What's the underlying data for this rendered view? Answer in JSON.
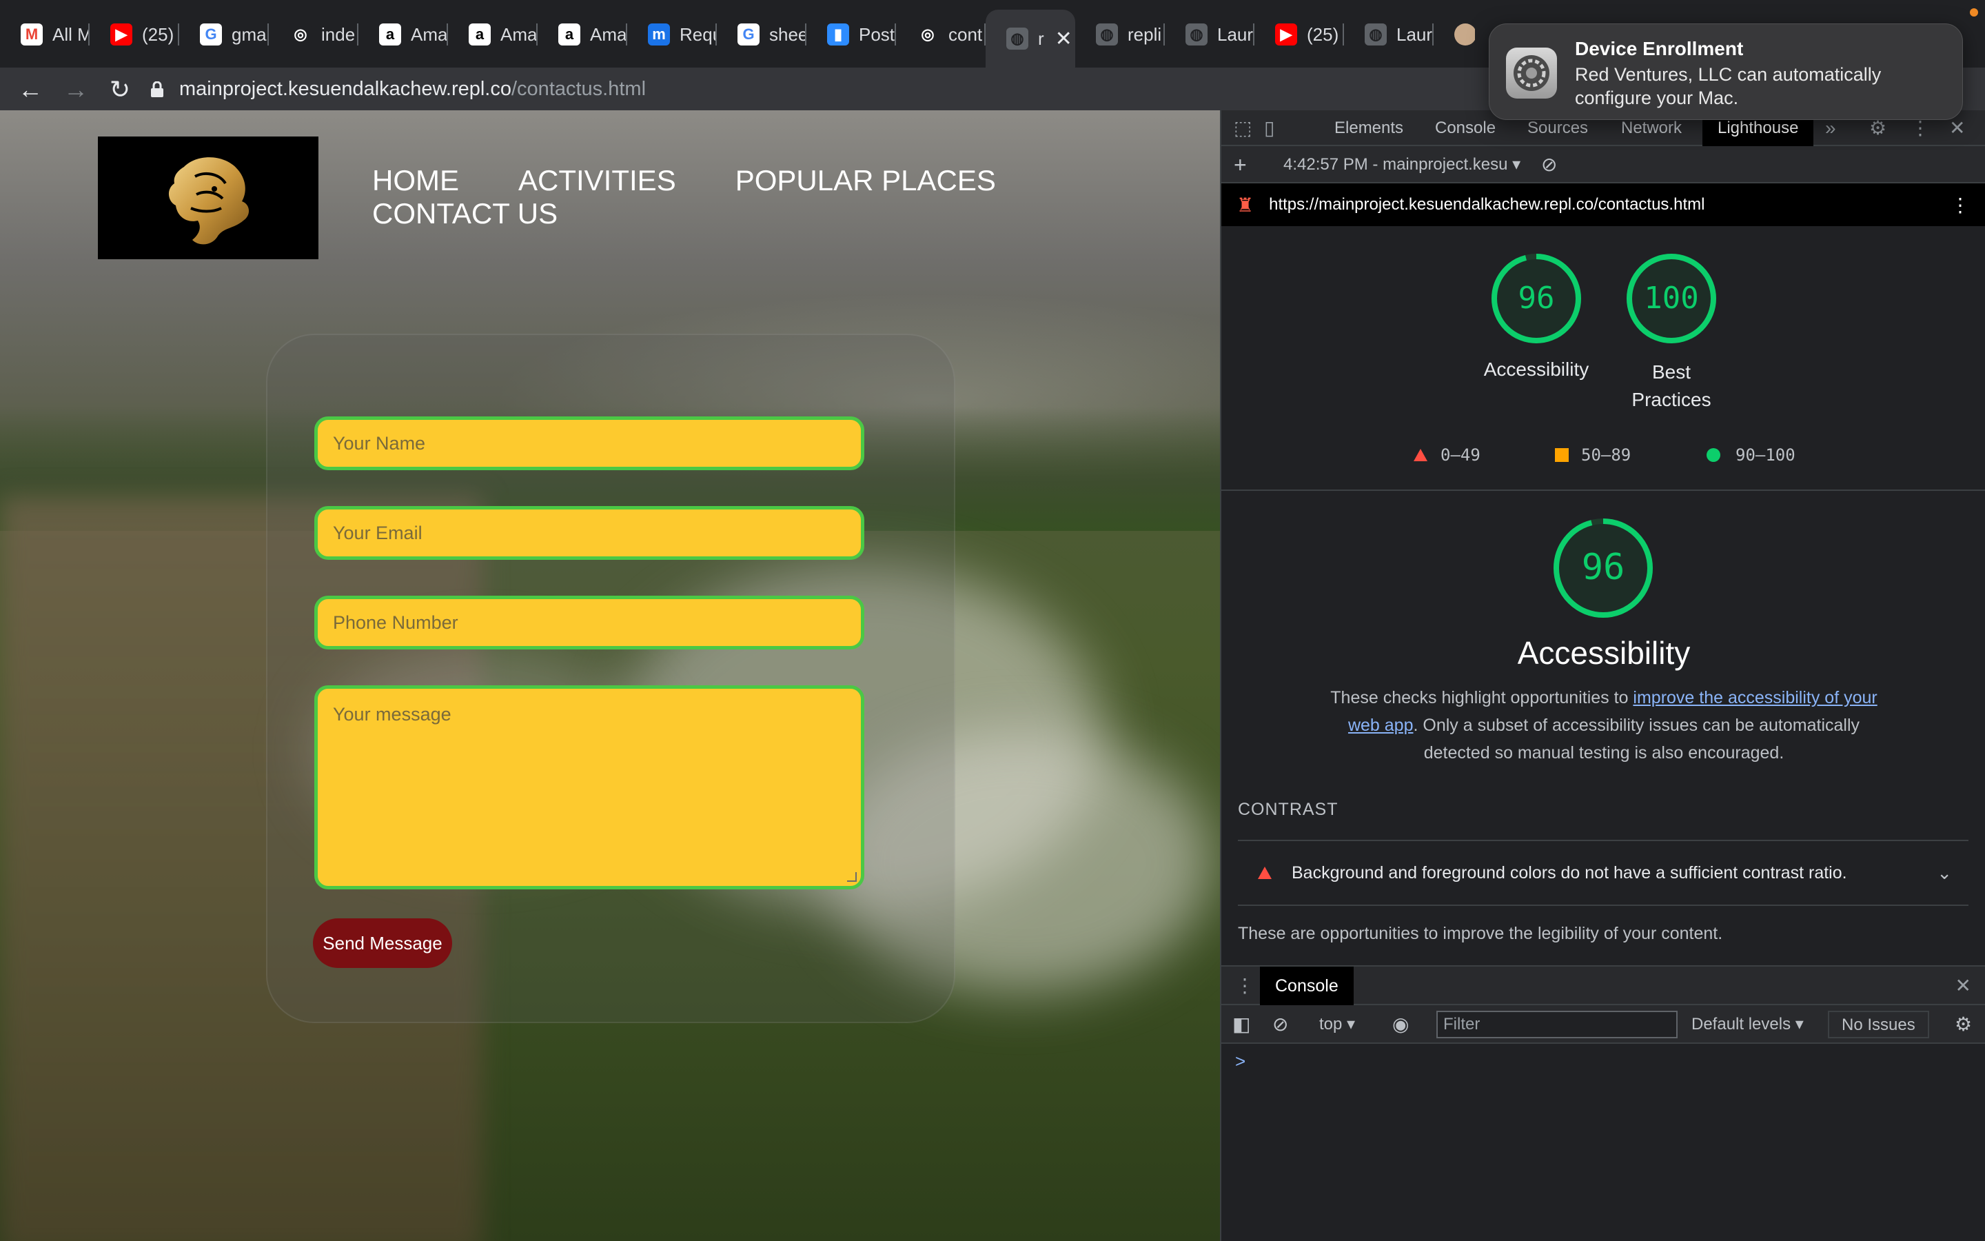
{
  "browser": {
    "tabs": [
      {
        "icon": "gmail-icon",
        "label": "All M",
        "fav_bg": "#ffffff",
        "fav_fg": "#ea4335",
        "glyph": "M"
      },
      {
        "icon": "youtube-icon",
        "label": "(25)",
        "fav_bg": "#ff0000",
        "fav_fg": "#ffffff",
        "glyph": "▶"
      },
      {
        "icon": "google-icon",
        "label": "gmai",
        "fav_bg": "#ffffff",
        "fav_fg": "#4285f4",
        "glyph": "G"
      },
      {
        "icon": "replit-icon",
        "label": "inde",
        "fav_bg": "#202124",
        "fav_fg": "#ffffff",
        "glyph": "◎"
      },
      {
        "icon": "amazon-icon",
        "label": "Ama",
        "fav_bg": "#ffffff",
        "fav_fg": "#000000",
        "glyph": "a"
      },
      {
        "icon": "amazon-icon",
        "label": "Ama",
        "fav_bg": "#ffffff",
        "fav_fg": "#000000",
        "glyph": "a"
      },
      {
        "icon": "amazon-icon",
        "label": "Ama",
        "fav_bg": "#ffffff",
        "fav_fg": "#000000",
        "glyph": "a"
      },
      {
        "icon": "m-icon",
        "label": "Requ",
        "fav_bg": "#1a73e8",
        "fav_fg": "#ffffff",
        "glyph": "m"
      },
      {
        "icon": "google-icon",
        "label": "shee",
        "fav_bg": "#ffffff",
        "fav_fg": "#4285f4",
        "glyph": "G"
      },
      {
        "icon": "zoom-icon",
        "label": "Post",
        "fav_bg": "#2d8cff",
        "fav_fg": "#ffffff",
        "glyph": "▮"
      },
      {
        "icon": "replit-icon",
        "label": "cont",
        "fav_bg": "#202124",
        "fav_fg": "#ffffff",
        "glyph": "◎"
      },
      {
        "icon": "globe-icon",
        "label": "r",
        "fav_bg": "#5f6368",
        "fav_fg": "#202124",
        "glyph": "◍",
        "active": true
      },
      {
        "icon": "globe-icon",
        "label": "repli",
        "fav_bg": "#5f6368",
        "fav_fg": "#202124",
        "glyph": "◍"
      },
      {
        "icon": "globe-icon",
        "label": "Laur",
        "fav_bg": "#5f6368",
        "fav_fg": "#202124",
        "glyph": "◍"
      },
      {
        "icon": "youtube-icon",
        "label": "(25)",
        "fav_bg": "#ff0000",
        "fav_fg": "#ffffff",
        "glyph": "▶"
      },
      {
        "icon": "globe-icon",
        "label": "Laur",
        "fav_bg": "#5f6368",
        "fav_fg": "#202124",
        "glyph": "◍"
      }
    ],
    "url_host": "mainproject.kesuendalkachew.repl.co",
    "url_path": "/contactus.html"
  },
  "site": {
    "nav": [
      "HOME",
      "ACTIVITIES",
      "POPULAR PLACES",
      "CONTACT US"
    ],
    "form": {
      "name_placeholder": "Your Name",
      "email_placeholder": "Your Email",
      "phone_placeholder": "Phone Number",
      "message_placeholder": "Your message",
      "submit_label": "Send Message"
    },
    "colors": {
      "field_bg": "#fdca2e",
      "field_border": "#4bc845",
      "button_bg": "#7b0f12"
    }
  },
  "devtools": {
    "tabs": [
      "Elements",
      "Console",
      "Sources",
      "Network",
      "Lighthouse"
    ],
    "active_tab": "Lighthouse",
    "report_label": "4:42:57 PM - mainproject.kesu",
    "report_url": "https://mainproject.kesuendalkachew.repl.co/contactus.html",
    "scores": [
      {
        "label": "Accessibility",
        "value": "96",
        "fraction": 0.96
      },
      {
        "label": "Best Practices",
        "label_line1": "Best",
        "label_line2": "Practices",
        "value": "100",
        "fraction": 1.0
      }
    ],
    "legend": [
      "0–49",
      "50–89",
      "90–100"
    ],
    "legend_colors": [
      "#ff4e42",
      "#ffa400",
      "#0cce6b"
    ],
    "big_score": {
      "value": "96",
      "fraction": 0.96,
      "title": "Accessibility"
    },
    "description_pre": "These checks highlight opportunities to ",
    "description_link": "improve the accessibility of your web app",
    "description_post": ". Only a subset of accessibility issues can be automatically detected so manual testing is also encouraged.",
    "section_title": "CONTRAST",
    "audit_item": "Background and foreground colors do not have a sufficient contrast ratio.",
    "section_note": "These are opportunities to improve the legibility of your content.",
    "drawer": {
      "tab": "Console",
      "context": "top",
      "filter_placeholder": "Filter",
      "levels": "Default levels",
      "issues": "No Issues",
      "prompt": ">"
    }
  },
  "notification": {
    "title": "Device Enrollment",
    "body": "Red Ventures, LLC can automatically configure your Mac."
  }
}
